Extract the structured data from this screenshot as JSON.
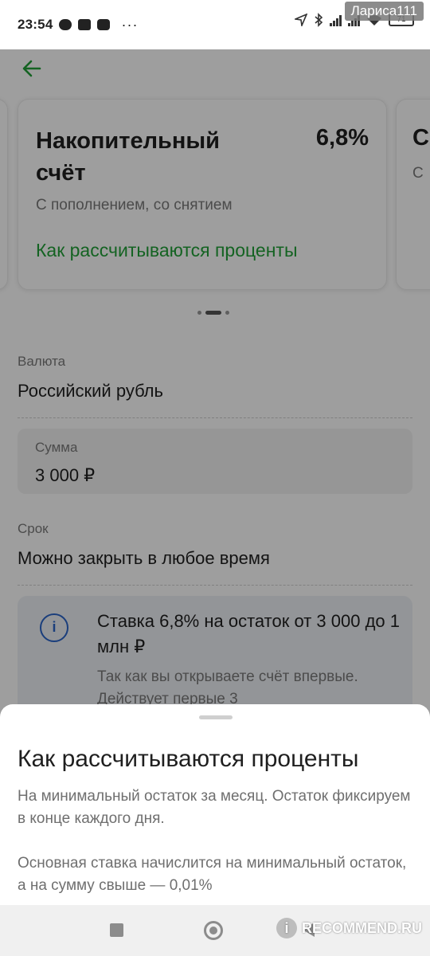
{
  "status_bar": {
    "time": "23:54",
    "dots": "···",
    "battery": "71",
    "username": "Лариса111"
  },
  "card": {
    "title": "Накопительный счёт",
    "rate": "6,8%",
    "subtitle": "С пополнением, со снятием",
    "link": "Как рассчитываются проценты"
  },
  "next_card": {
    "title_fragment": "С",
    "sub_fragment": "С"
  },
  "pager": {
    "count": 3,
    "active": 1
  },
  "currency": {
    "label": "Валюта",
    "value": "Российский рубль"
  },
  "amount": {
    "label": "Сумма",
    "value": "3 000 ₽"
  },
  "term": {
    "label": "Срок",
    "value": "Можно закрыть в любое время"
  },
  "info": {
    "icon": "info-icon",
    "title": "Ставка 6,8% на остаток от 3 000 до 1 млн ₽",
    "text": "Так как вы открываете счёт впервые. Действует первые 3"
  },
  "sheet": {
    "title": "Как рассчитываются проценты",
    "paragraph1": "На минимальный остаток за месяц. Остаток фиксируем в конце каждого дня.",
    "paragraph2": "Основная ставка начислится на минимальный остаток, а на сумму свыше — 0,01%"
  },
  "watermark": {
    "logo": "i",
    "text": "RECOMMEND.RU"
  },
  "colors": {
    "accent_green": "#21a038",
    "info_blue": "#2a64c8"
  }
}
